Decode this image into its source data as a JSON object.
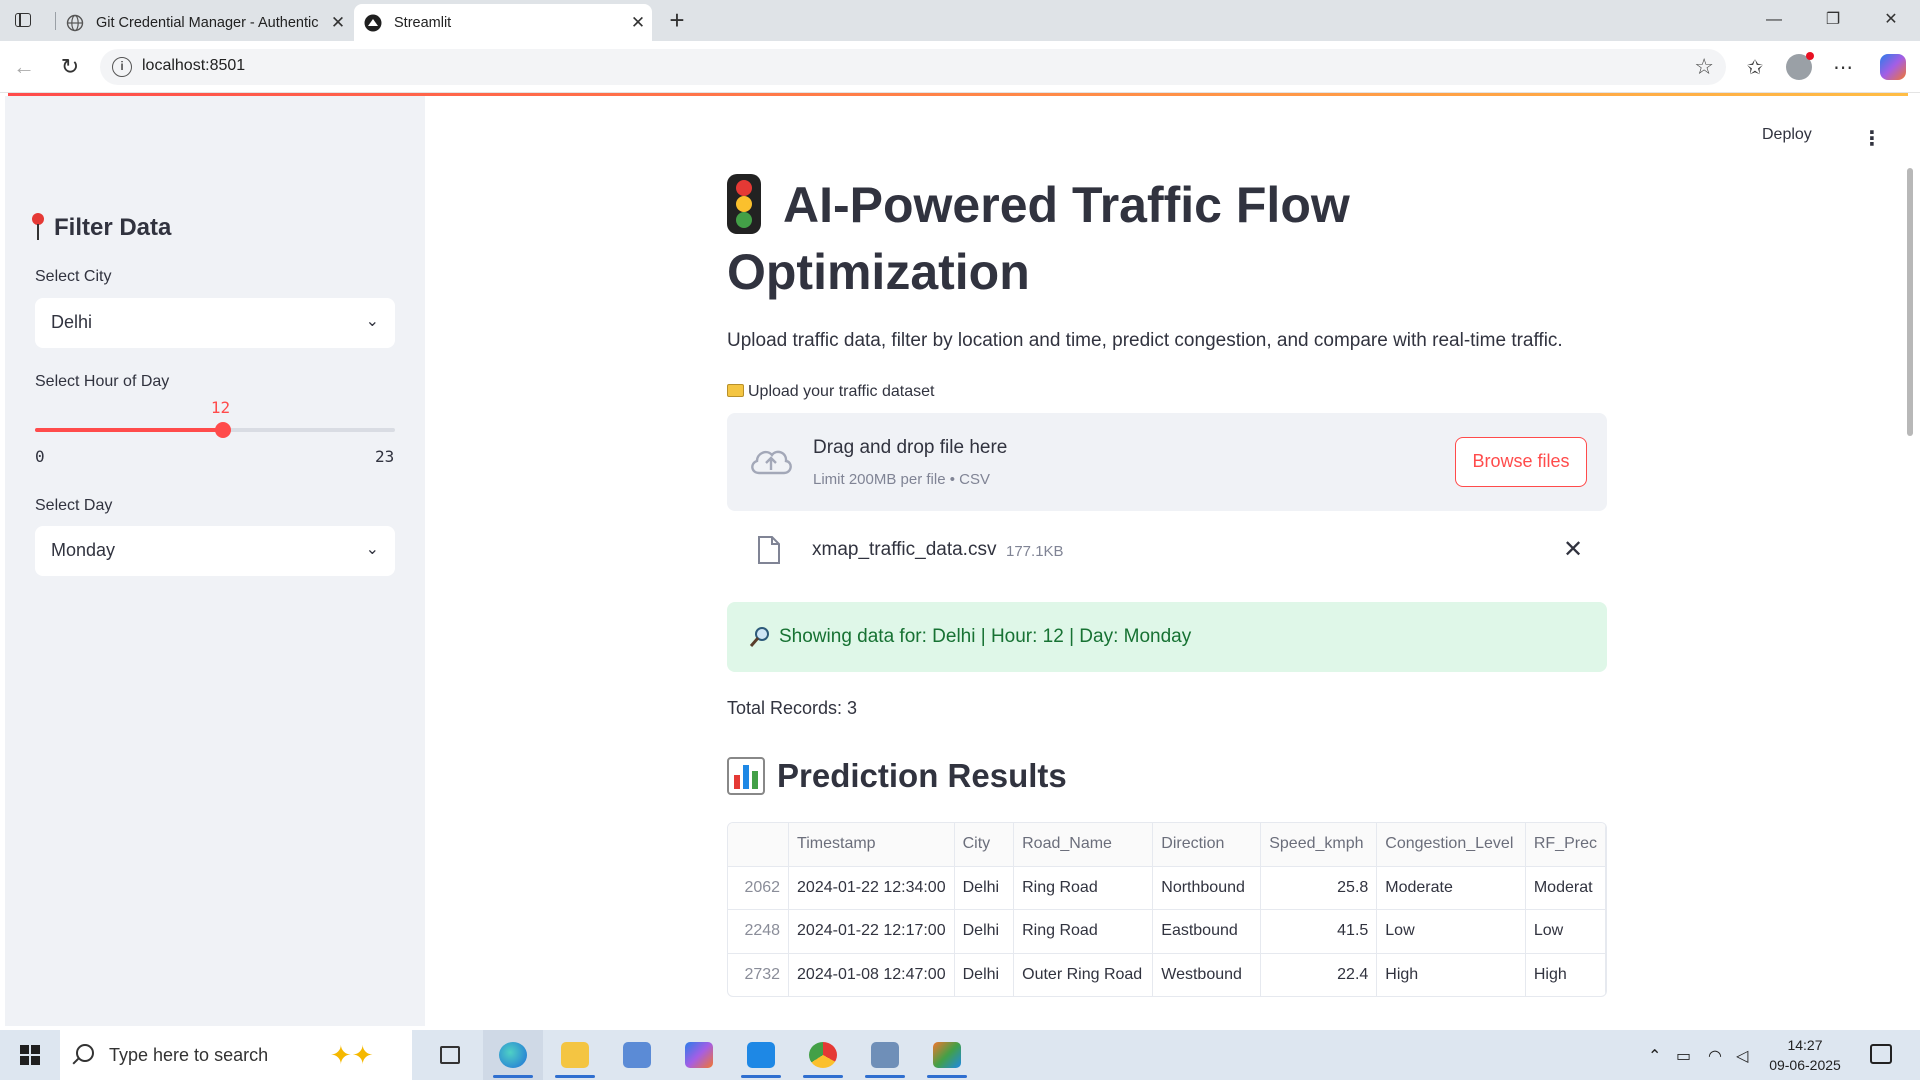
{
  "browser": {
    "tabs": [
      {
        "title": "Git Credential Manager - Authentic",
        "active": false
      },
      {
        "title": "Streamlit",
        "active": true
      }
    ],
    "url": "localhost:8501"
  },
  "app": {
    "header": {
      "deploy_label": "Deploy"
    },
    "sidebar": {
      "title": "Filter Data",
      "city_label": "Select City",
      "city_value": "Delhi",
      "hour_label": "Select Hour of Day",
      "hour_value": "12",
      "hour_min": "0",
      "hour_max": "23",
      "hour_fraction": 0.522,
      "day_label": "Select Day",
      "day_value": "Monday"
    },
    "main": {
      "title": "AI-Powered Traffic Flow Optimization",
      "subtitle": "Upload traffic data, filter by location and time, predict congestion, and compare with real-time traffic.",
      "upload_label": "Upload your traffic dataset",
      "dropzone_title": "Drag and drop file here",
      "dropzone_limit": "Limit 200MB per file • CSV",
      "browse_label": "Browse files",
      "file_name": "xmap_traffic_data.csv",
      "file_size": "177.1KB",
      "info_text": "Showing data for: Delhi | Hour: 12 | Day: Monday",
      "total_records": "Total Records: 3",
      "results_title": "Prediction Results",
      "table": {
        "columns": [
          "",
          "Timestamp",
          "City",
          "Road_Name",
          "Direction",
          "Speed_kmph",
          "Congestion_Level",
          "RF_Prec"
        ],
        "rows": [
          [
            "2062",
            "2024-01-22 12:34:00",
            "Delhi",
            "Ring Road",
            "Northbound",
            "25.8",
            "Moderate",
            "Moderat"
          ],
          [
            "2248",
            "2024-01-22 12:17:00",
            "Delhi",
            "Ring Road",
            "Eastbound",
            "41.5",
            "Low",
            "Low"
          ],
          [
            "2732",
            "2024-01-08 12:47:00",
            "Delhi",
            "Outer Ring Road",
            "Westbound",
            "22.4",
            "High",
            "High"
          ]
        ]
      }
    }
  },
  "taskbar": {
    "search_placeholder": "Type here to search",
    "time": "14:27",
    "date": "09-06-2025"
  },
  "colors": {
    "accent": "#ff4b4b",
    "success_bg": "#dff7e8",
    "success_text": "#177233",
    "sidebar_bg": "#f0f2f6"
  }
}
